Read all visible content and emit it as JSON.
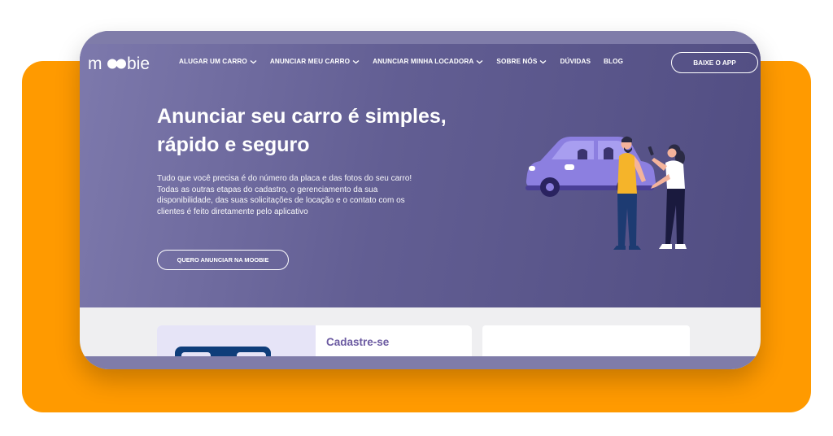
{
  "brand": {
    "logo_text": "moobie"
  },
  "nav": {
    "items": [
      {
        "label": "ALUGAR UM CARRO",
        "has_dropdown": true
      },
      {
        "label": "ANUNCIAR MEU CARRO",
        "has_dropdown": true
      },
      {
        "label": "ANUNCIAR MINHA LOCADORA",
        "has_dropdown": true
      },
      {
        "label": "SOBRE NÓS",
        "has_dropdown": true
      },
      {
        "label": "DÚVIDAS",
        "has_dropdown": false
      },
      {
        "label": "BLOG",
        "has_dropdown": false
      }
    ],
    "app_button": "BAIXE O APP"
  },
  "hero": {
    "title": "Anunciar seu carro é simples, rápido e seguro",
    "description": "Tudo que você precisa é do número da placa e das fotos do seu carro! Todas as outras etapas do cadastro, o gerenciamento da sua disponibilidade, das suas solicitações de locação e o contato com os clientes é feito diretamente pelo aplicativo",
    "cta_label": "QUERO ANUNCIAR NA MOOBIE"
  },
  "cards": {
    "first_title": "Cadastre-se"
  },
  "colors": {
    "accent_orange": "#ff9a00",
    "hero_purple": "#625e93",
    "card_title": "#6b5aa1",
    "car_purple": "#8c7fe0"
  }
}
